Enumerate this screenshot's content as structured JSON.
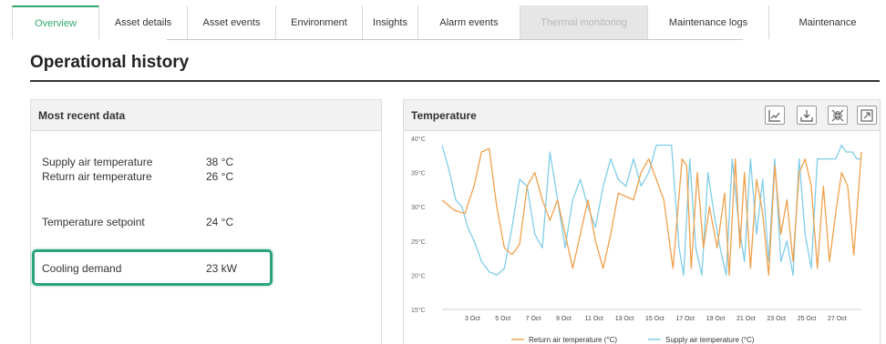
{
  "tabs": [
    {
      "label": "Overview",
      "state": "active"
    },
    {
      "label": "Asset details",
      "state": "normal"
    },
    {
      "label": "Asset events",
      "state": "normal"
    },
    {
      "label": "Environment",
      "state": "normal"
    },
    {
      "label": "Insights",
      "state": "normal"
    },
    {
      "label": "Alarm events",
      "state": "normal"
    },
    {
      "label": "Thermal monitoring",
      "state": "disabled"
    },
    {
      "label": "Maintenance logs",
      "state": "normal"
    },
    {
      "label": "Maintenance",
      "state": "normal"
    }
  ],
  "page_title": "Operational history",
  "recent_panel": {
    "title": "Most recent data",
    "rows": [
      {
        "label": "Supply air temperature",
        "value": "38 °C"
      },
      {
        "label": "Return air temperature",
        "value": "26 °C"
      },
      {
        "label": "Temperature setpoint",
        "value": "24 °C"
      },
      {
        "label": "Cooling demand",
        "value": "23 kW"
      }
    ],
    "highlight_color": "#2aa37d"
  },
  "chart_panel": {
    "title": "Temperature",
    "toolbar_icons": [
      "line-chart-icon",
      "download-icon",
      "collapse-arrows-icon",
      "expand-icon"
    ]
  },
  "colors": {
    "accent": "#2fa86a",
    "return_series": "#f0a04b",
    "supply_series": "#7fcde8"
  },
  "chart_data": {
    "type": "line",
    "title": "",
    "ylim": [
      15,
      40
    ],
    "yticks": [
      "15°C",
      "20°C",
      "25°C",
      "30°C",
      "35°C",
      "40°C"
    ],
    "xticks": [
      "3 Oct",
      "5 Oct",
      "7 Oct",
      "9 Oct",
      "11 Oct",
      "13 Oct",
      "15 Oct",
      "17 Oct",
      "19 Oct",
      "21 Oct",
      "23 Oct",
      "25 Oct",
      "27 Oct"
    ],
    "x_range_days": [
      1,
      28.6
    ],
    "grid": false,
    "legend": "bottom",
    "series": [
      {
        "name": "Return air temperature (°C)",
        "color": "#f0a04b",
        "points": [
          [
            1,
            31
          ],
          [
            1.8,
            29.5
          ],
          [
            2.5,
            29
          ],
          [
            3.1,
            33
          ],
          [
            3.6,
            38
          ],
          [
            4.1,
            38.5
          ],
          [
            4.6,
            30
          ],
          [
            5.1,
            24
          ],
          [
            5.6,
            23
          ],
          [
            6.1,
            24.5
          ],
          [
            6.6,
            33
          ],
          [
            7.1,
            35
          ],
          [
            7.6,
            31
          ],
          [
            8.1,
            28
          ],
          [
            8.6,
            31
          ],
          [
            9.1,
            26
          ],
          [
            9.6,
            21
          ],
          [
            10.1,
            26
          ],
          [
            10.6,
            31
          ],
          [
            11.1,
            25
          ],
          [
            11.6,
            21
          ],
          [
            12.1,
            26
          ],
          [
            12.6,
            32
          ],
          [
            13.1,
            31.5
          ],
          [
            13.6,
            31
          ],
          [
            14.1,
            35
          ],
          [
            14.6,
            37
          ],
          [
            15.1,
            34
          ],
          [
            15.6,
            31
          ],
          [
            16.2,
            21
          ],
          [
            16.8,
            37
          ],
          [
            17.1,
            36
          ],
          [
            17.4,
            21
          ],
          [
            17.8,
            35
          ],
          [
            18.2,
            24
          ],
          [
            18.6,
            30
          ],
          [
            19.1,
            24
          ],
          [
            19.6,
            32
          ],
          [
            19.9,
            20
          ],
          [
            20.3,
            37
          ],
          [
            20.6,
            24
          ],
          [
            20.9,
            35
          ],
          [
            21.3,
            21
          ],
          [
            21.7,
            34
          ],
          [
            22.1,
            29
          ],
          [
            22.5,
            20
          ],
          [
            22.9,
            36
          ],
          [
            23.3,
            26
          ],
          [
            23.7,
            31
          ],
          [
            24.1,
            22
          ],
          [
            24.5,
            35
          ],
          [
            24.9,
            37
          ],
          [
            25.3,
            33
          ],
          [
            25.7,
            21
          ],
          [
            26.1,
            33
          ],
          [
            26.5,
            22
          ],
          [
            26.9,
            29
          ],
          [
            27.3,
            35
          ],
          [
            27.7,
            33
          ],
          [
            28.1,
            23
          ],
          [
            28.6,
            38
          ]
        ]
      },
      {
        "name": "Supply air temperature (°C)",
        "color": "#7fcde8",
        "points": [
          [
            1,
            39
          ],
          [
            1.5,
            35
          ],
          [
            1.9,
            31
          ],
          [
            2.3,
            30
          ],
          [
            2.7,
            27
          ],
          [
            3.2,
            24.5
          ],
          [
            3.6,
            22
          ],
          [
            4.1,
            20.5
          ],
          [
            4.6,
            20
          ],
          [
            5.1,
            21
          ],
          [
            5.6,
            27
          ],
          [
            6.1,
            34
          ],
          [
            6.6,
            33
          ],
          [
            7.1,
            26
          ],
          [
            7.6,
            24
          ],
          [
            8.1,
            38
          ],
          [
            8.6,
            31
          ],
          [
            9.1,
            24
          ],
          [
            9.6,
            31
          ],
          [
            10.1,
            34
          ],
          [
            10.6,
            30
          ],
          [
            11.1,
            27
          ],
          [
            11.6,
            33
          ],
          [
            12.1,
            37
          ],
          [
            12.6,
            34
          ],
          [
            13.1,
            33
          ],
          [
            13.6,
            37
          ],
          [
            14.1,
            33
          ],
          [
            14.6,
            35
          ],
          [
            15.1,
            39
          ],
          [
            15.6,
            39
          ],
          [
            16.1,
            39
          ],
          [
            16.6,
            24
          ],
          [
            16.9,
            20
          ],
          [
            17.3,
            37
          ],
          [
            17.7,
            24
          ],
          [
            18.1,
            20
          ],
          [
            18.5,
            35
          ],
          [
            18.9,
            29
          ],
          [
            19.3,
            24
          ],
          [
            19.7,
            20
          ],
          [
            20.1,
            37
          ],
          [
            20.5,
            28
          ],
          [
            20.9,
            22
          ],
          [
            21.3,
            37
          ],
          [
            21.7,
            26
          ],
          [
            22.1,
            34
          ],
          [
            22.5,
            22
          ],
          [
            22.9,
            37
          ],
          [
            23.3,
            22
          ],
          [
            23.7,
            25
          ],
          [
            24.1,
            20
          ],
          [
            24.5,
            37
          ],
          [
            24.9,
            26
          ],
          [
            25.3,
            21
          ],
          [
            25.7,
            37
          ],
          [
            26.1,
            37
          ],
          [
            26.5,
            37
          ],
          [
            26.9,
            37
          ],
          [
            27.3,
            39
          ],
          [
            27.6,
            38
          ],
          [
            28,
            38
          ],
          [
            28.3,
            37
          ],
          [
            28.6,
            37
          ]
        ]
      }
    ]
  }
}
